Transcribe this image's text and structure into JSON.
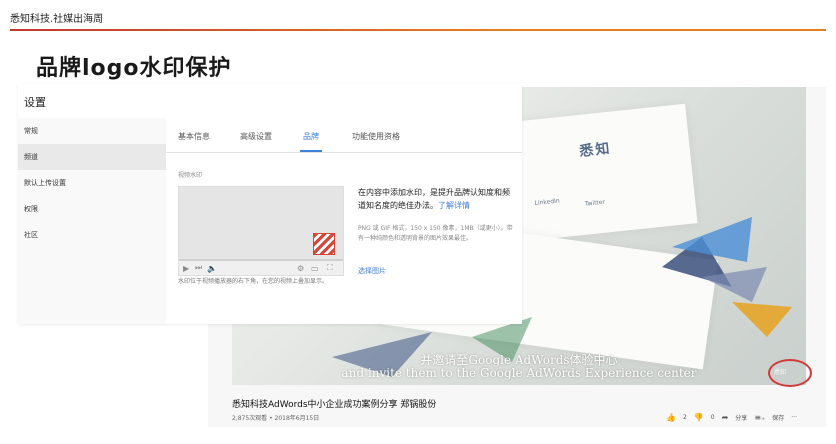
{
  "header": {
    "brand": "悉知科技.社媒出海周",
    "rule_color": "#e67e22"
  },
  "slide": {
    "title": "品牌logo水印保护"
  },
  "settings": {
    "title": "设置",
    "sidebar": [
      "常规",
      "频道",
      "默认上传设置",
      "权限",
      "社区"
    ],
    "active_sidebar": "频道",
    "tabs": [
      "基本信息",
      "高级设置",
      "品牌",
      "功能使用资格"
    ],
    "active_tab": "品牌",
    "section_label": "视频水印",
    "preview_note": "水印位于视频播放器的右下角，在您的视频上叠加显示。",
    "description": "在内容中添加水印，是提升品牌认知度和频道知名度的绝佳办法。",
    "learn_more": "了解详情",
    "format_note": "PNG 或 GIF 格式，150 x 150 像素，1MB（或更小）。带有一种纯颜色和透明背景的图片效果最佳。",
    "choose_image": "选择图片",
    "accent": "#3f7fd9"
  },
  "video": {
    "caption_cn": "并邀请至Google AdWords体验中心",
    "caption_en": "and invite them to the Google AdWords Experience center",
    "paper_text_1": "悉知",
    "paper_text_2": "LinkedIn",
    "paper_text_3": "Twitter",
    "watermark_text": "悉知",
    "title": "悉知科技AdWords中小企业成功案例分享 郑锅股份",
    "meta": "2,875次观看 • 2018年6月15日",
    "likes": "2",
    "dislikes": "0",
    "share": "分享",
    "save": "保存",
    "more": "···"
  },
  "icons": {
    "like": "thumbs-up-icon",
    "dislike": "thumbs-down-icon",
    "share": "share-icon",
    "save": "save-playlist-icon",
    "play": "play-icon",
    "next": "next-icon",
    "volume": "volume-icon",
    "settings": "gear-icon",
    "theater": "theater-icon",
    "fullscreen": "fullscreen-icon"
  }
}
